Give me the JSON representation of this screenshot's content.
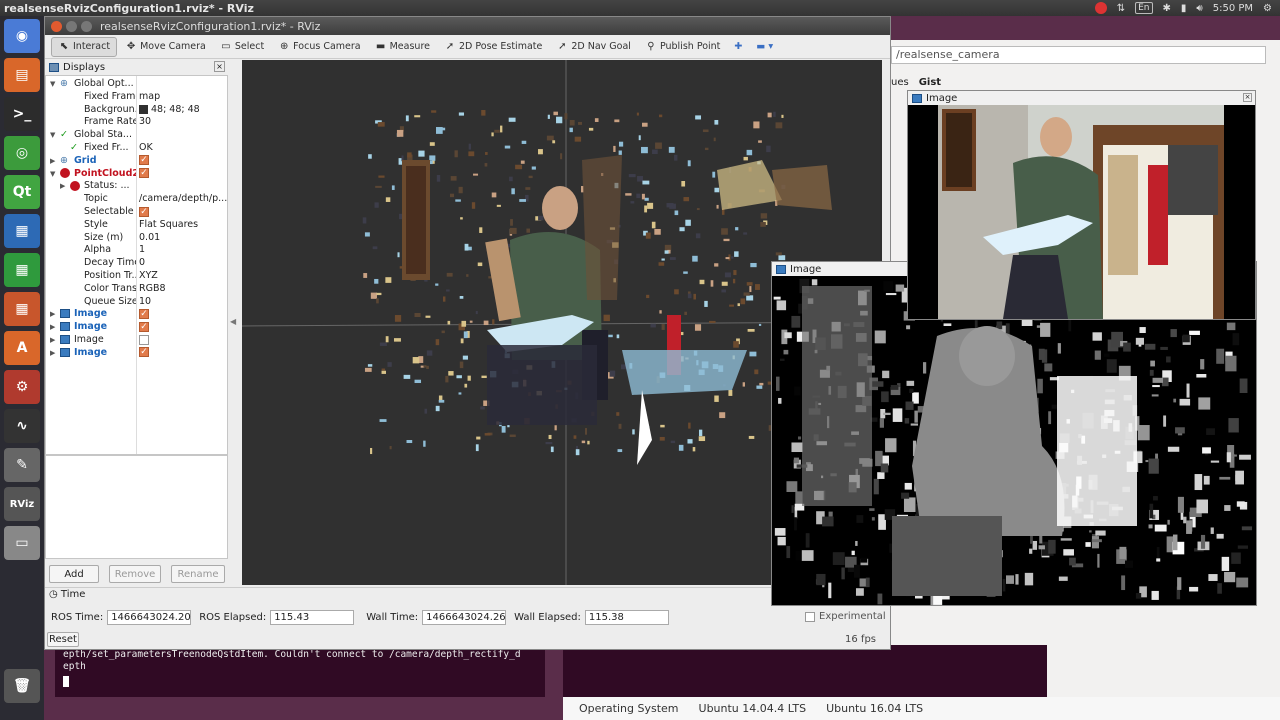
{
  "topbar": {
    "title": "realsenseRvizConfiguration1.rviz* - RViz",
    "lang": "En",
    "time": "5:50 PM"
  },
  "launcher": {
    "items": [
      {
        "name": "ubuntu-dash",
        "glyph": "◉",
        "color": "#4a7bd6"
      },
      {
        "name": "files",
        "glyph": "▤",
        "color": "#d9672a"
      },
      {
        "name": "terminal",
        "glyph": ">_",
        "color": "#2c2c2c"
      },
      {
        "name": "chrome",
        "glyph": "◎",
        "color": "#3c9b3c"
      },
      {
        "name": "qt-creator",
        "glyph": "Qt",
        "color": "#41a541"
      },
      {
        "name": "writer",
        "glyph": "▦",
        "color": "#2d6ab5"
      },
      {
        "name": "calc",
        "glyph": "▦",
        "color": "#2f9a3d"
      },
      {
        "name": "impress",
        "glyph": "▦",
        "color": "#c8562c"
      },
      {
        "name": "software-center",
        "glyph": "A",
        "color": "#d9672a"
      },
      {
        "name": "settings",
        "glyph": "⚙",
        "color": "#b03a2e"
      },
      {
        "name": "system-monitor",
        "glyph": "∿",
        "color": "#333"
      },
      {
        "name": "text-editor",
        "glyph": "✎",
        "color": "#666"
      },
      {
        "name": "rviz",
        "glyph": "RViz",
        "color": "#555"
      },
      {
        "name": "drive",
        "glyph": "▭",
        "color": "#888"
      },
      {
        "name": "trash",
        "glyph": "🗑",
        "color": "#555"
      }
    ]
  },
  "background": {
    "url": "/realsense_camera",
    "gh_tabs": [
      "ues",
      "Gist"
    ],
    "terminal_text": "epth/set_parametersTreenodeQstdItem. Couldn't connect to /camera/depth_rectify_d\nepth",
    "os_table": [
      "Operating System",
      "Ubuntu 14.04.4 LTS",
      "Ubuntu 16.04 LTS"
    ]
  },
  "rviz": {
    "title": "realsenseRvizConfiguration1.rviz* - RViz",
    "toolbar": [
      {
        "label": "Interact",
        "icon": "cursor-icon",
        "glyph": "⬉",
        "active": true
      },
      {
        "label": "Move Camera",
        "icon": "move-icon",
        "glyph": "✥",
        "active": false
      },
      {
        "label": "Select",
        "icon": "select-icon",
        "glyph": "▭",
        "active": false
      },
      {
        "label": "Focus Camera",
        "icon": "focus-icon",
        "glyph": "⊕",
        "active": false
      },
      {
        "label": "Measure",
        "icon": "ruler-icon",
        "glyph": "▬",
        "active": false
      },
      {
        "label": "2D Pose Estimate",
        "icon": "pose-arrow-icon",
        "glyph": "➚",
        "active": false
      },
      {
        "label": "2D Nav Goal",
        "icon": "nav-arrow-icon",
        "glyph": "➚",
        "active": false
      },
      {
        "label": "Publish Point",
        "icon": "map-pin-icon",
        "glyph": "⚲",
        "active": false
      }
    ],
    "displays_title": "Displays",
    "tree": [
      {
        "depth": 0,
        "expander": "▼",
        "icon": "globe",
        "label": "Global Opt...",
        "value": ""
      },
      {
        "depth": 1,
        "label": "Fixed Frame",
        "value": "map"
      },
      {
        "depth": 1,
        "label": "Backgroun...",
        "value": "48; 48; 48",
        "swatch": "#303030"
      },
      {
        "depth": 1,
        "label": "Frame Rate",
        "value": "30"
      },
      {
        "depth": 0,
        "expander": "▼",
        "icon": "check",
        "label": "Global Sta...",
        "value": ""
      },
      {
        "depth": 1,
        "icon": "check",
        "label": "Fixed Fr...",
        "value": "OK"
      },
      {
        "depth": 0,
        "expander": "▶",
        "icon": "grid",
        "label": "Grid",
        "value": "",
        "checkbox": true,
        "style": "blue"
      },
      {
        "depth": 0,
        "expander": "▼",
        "icon": "error",
        "label": "PointCloud2",
        "value": "",
        "checkbox": true,
        "style": "red"
      },
      {
        "depth": 1,
        "expander": "▶",
        "icon": "error",
        "label": "Status: ...",
        "value": ""
      },
      {
        "depth": 1,
        "label": "Topic",
        "value": "/camera/depth/p..."
      },
      {
        "depth": 1,
        "label": "Selectable",
        "value": "",
        "checkbox": true
      },
      {
        "depth": 1,
        "label": "Style",
        "value": "Flat Squares"
      },
      {
        "depth": 1,
        "label": "Size (m)",
        "value": "0.01"
      },
      {
        "depth": 1,
        "label": "Alpha",
        "value": "1"
      },
      {
        "depth": 1,
        "label": "Decay Time",
        "value": "0"
      },
      {
        "depth": 1,
        "label": "Position Tr...",
        "value": "XYZ"
      },
      {
        "depth": 1,
        "label": "Color Trans...",
        "value": "RGB8"
      },
      {
        "depth": 1,
        "label": "Queue Size",
        "value": "10"
      },
      {
        "depth": 0,
        "expander": "▶",
        "icon": "image",
        "label": "Image",
        "value": "",
        "checkbox": true,
        "style": "blue"
      },
      {
        "depth": 0,
        "expander": "▶",
        "icon": "image",
        "label": "Image",
        "value": "",
        "checkbox": true,
        "style": "blue"
      },
      {
        "depth": 0,
        "expander": "▶",
        "icon": "image",
        "label": "Image",
        "value": "",
        "checkbox": false,
        "style": "plain"
      },
      {
        "depth": 0,
        "expander": "▶",
        "icon": "image",
        "label": "Image",
        "value": "",
        "checkbox": true,
        "style": "blue"
      }
    ],
    "buttons": {
      "add": "Add",
      "remove": "Remove",
      "rename": "Rename"
    },
    "time": {
      "title": "Time",
      "ros_time_label": "ROS Time:",
      "ros_time": "1466643024.20",
      "ros_elapsed_label": "ROS Elapsed:",
      "ros_elapsed": "115.43",
      "wall_time_label": "Wall Time:",
      "wall_time": "1466643024.26",
      "wall_elapsed_label": "Wall Elapsed:",
      "wall_elapsed": "115.38",
      "experimental": "Experimental",
      "reset": "Reset",
      "fps": "16 fps"
    }
  },
  "image_windows": {
    "depth_title": "Image",
    "color_title": "Image"
  }
}
